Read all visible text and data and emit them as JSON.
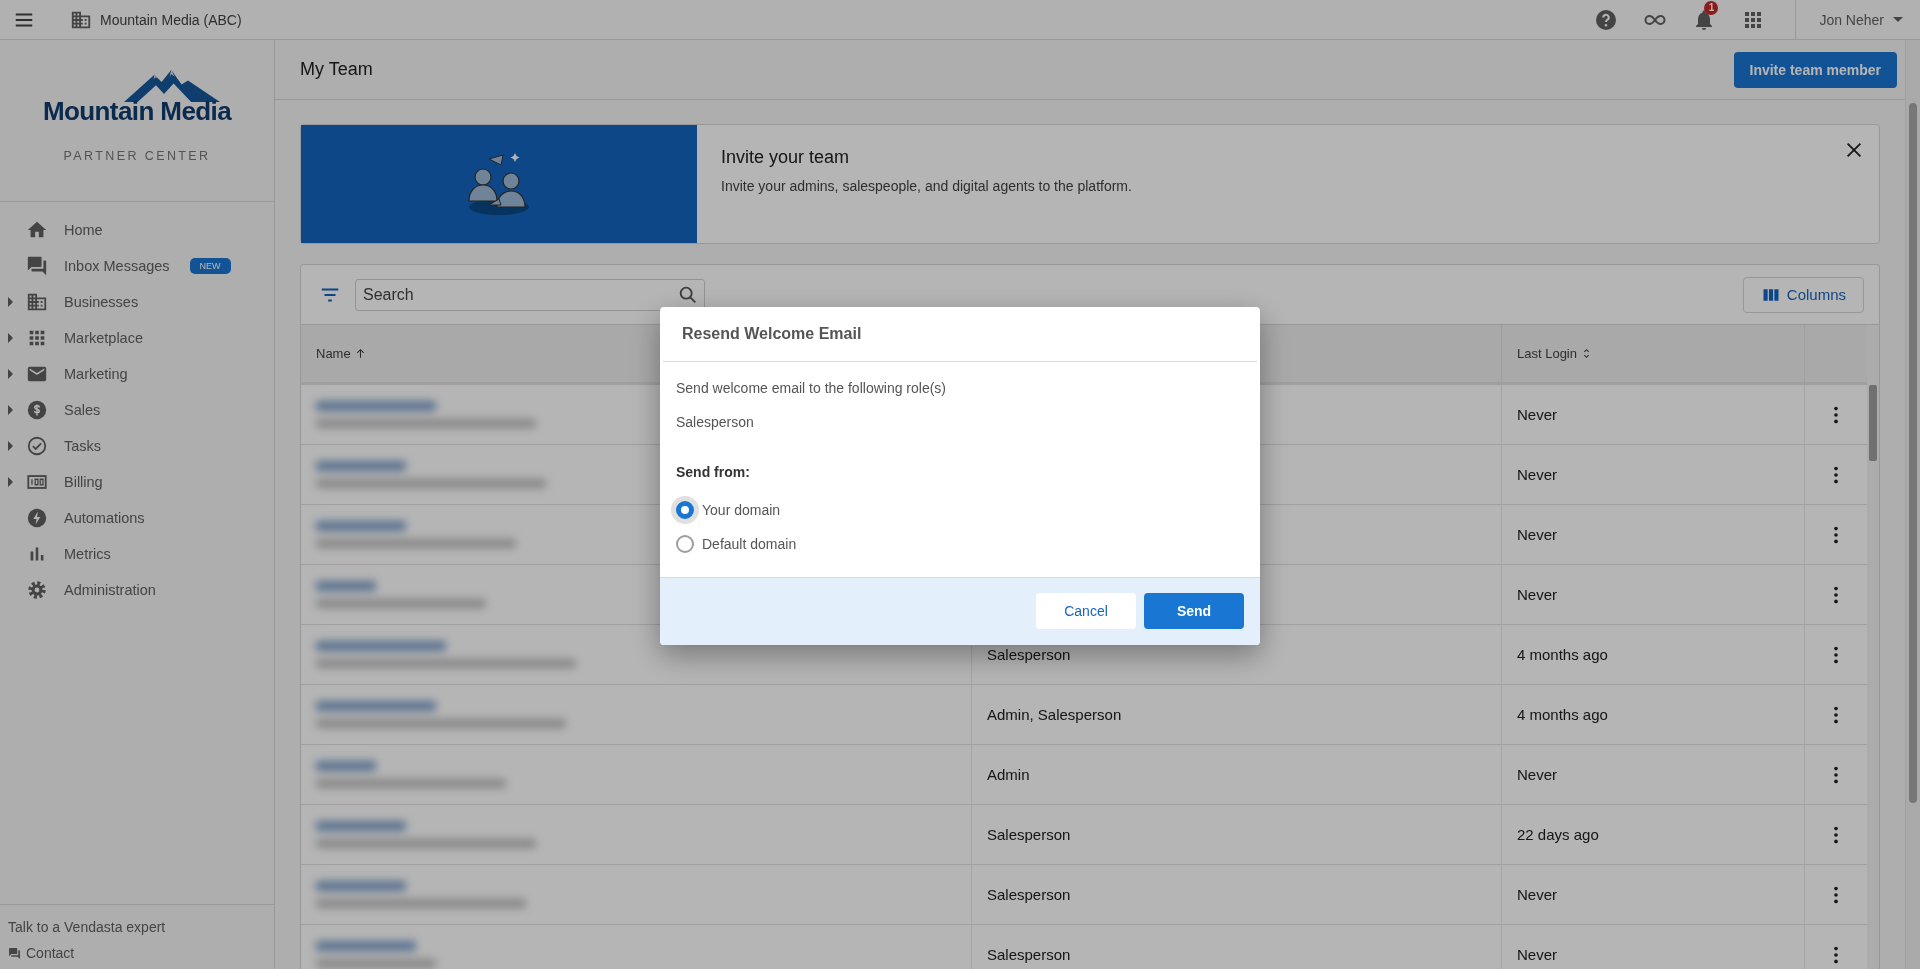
{
  "top_bar": {
    "account": "Mountain Media (ABC)",
    "notification_count": "1",
    "user": "Jon Neher"
  },
  "sidebar": {
    "logo_text": "Mountain Media",
    "subtitle": "PARTNER CENTER",
    "items": [
      {
        "label": "Home",
        "expandable": false
      },
      {
        "label": "Inbox Messages",
        "expandable": false,
        "badge": "NEW"
      },
      {
        "label": "Businesses",
        "expandable": true
      },
      {
        "label": "Marketplace",
        "expandable": true
      },
      {
        "label": "Marketing",
        "expandable": true
      },
      {
        "label": "Sales",
        "expandable": true
      },
      {
        "label": "Tasks",
        "expandable": true
      },
      {
        "label": "Billing",
        "expandable": true
      },
      {
        "label": "Automations",
        "expandable": false
      },
      {
        "label": "Metrics",
        "expandable": false
      },
      {
        "label": "Administration",
        "expandable": false
      }
    ],
    "footer_text": "Talk to a Vendasta expert",
    "contact": "Contact"
  },
  "page": {
    "title": "My Team",
    "invite_button": "Invite team member"
  },
  "banner": {
    "title": "Invite your team",
    "text": "Invite your admins, salespeople, and digital agents to the platform."
  },
  "table": {
    "search_placeholder": "Search",
    "columns_button": "Columns",
    "name_column": {
      "label": "Name",
      "sorted": true
    },
    "last_login_column": {
      "label": "Last Login",
      "sorted": false
    },
    "rows": [
      {
        "last_login": "Never"
      },
      {
        "last_login": "Never"
      },
      {
        "last_login": "Never"
      },
      {
        "last_login": "Never"
      },
      {
        "role": "Salesperson",
        "last_login": "4 months ago"
      },
      {
        "role": "Admin, Salesperson",
        "last_login": "4 months ago"
      },
      {
        "role": "Admin",
        "last_login": "Never"
      },
      {
        "role": "Salesperson",
        "last_login": "22 days ago"
      },
      {
        "role": "Salesperson",
        "last_login": "Never"
      },
      {
        "role": "Salesperson",
        "last_login": "Never"
      }
    ]
  },
  "dialog": {
    "title": "Resend Welcome Email",
    "message": "Send welcome email to the following role(s)",
    "roles": "Salesperson",
    "send_from_label": "Send from:",
    "options": [
      {
        "label": "Your domain",
        "selected": true
      },
      {
        "label": "Default domain",
        "selected": false
      }
    ],
    "cancel_button": "Cancel",
    "send_button": "Send"
  }
}
